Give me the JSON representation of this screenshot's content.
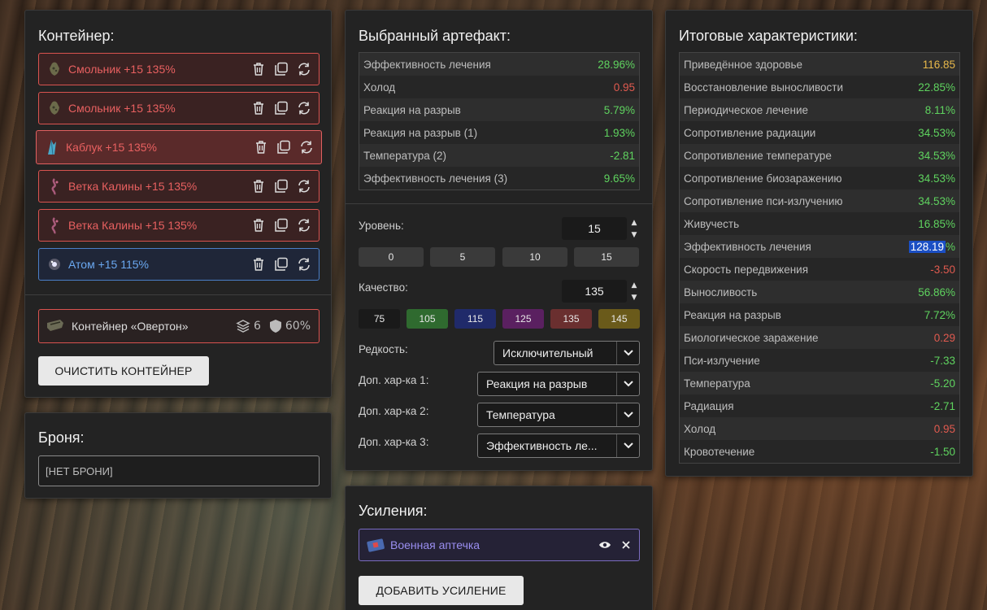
{
  "container": {
    "title": "Контейнер:",
    "items": [
      {
        "label": "Смольник +15 135%"
      },
      {
        "label": "Смольник +15 135%"
      },
      {
        "label": "Каблук +15 135%"
      },
      {
        "label": "Ветка Калины +15 135%"
      },
      {
        "label": "Ветка Калины +15 135%"
      },
      {
        "label": "Атом +15 115%"
      }
    ],
    "overton": {
      "label": "Контейнер «Овертон»",
      "slots": "6",
      "protection": "60%"
    },
    "clear_label": "ОЧИСТИТЬ КОНТЕЙНЕР"
  },
  "armor": {
    "title": "Броня:",
    "value": "[НЕТ БРОНИ]"
  },
  "artifact": {
    "title": "Выбранный артефакт:",
    "stats": [
      {
        "name": "Эффективность лечения",
        "value": "28.96%",
        "color": "#5fd35f"
      },
      {
        "name": "Холод",
        "value": "0.95",
        "color": "#e05a4f"
      },
      {
        "name": "Реакция на разрыв",
        "value": "5.79%",
        "color": "#5fd35f"
      },
      {
        "name": "Реакция на разрыв (1)",
        "value": "1.93%",
        "color": "#5fd35f"
      },
      {
        "name": "Температура (2)",
        "value": "-2.81",
        "color": "#5fd35f"
      },
      {
        "name": "Эффективность лечения (3)",
        "value": "9.65%",
        "color": "#5fd35f"
      }
    ],
    "level_label": "Уровень:",
    "level_value": "15",
    "level_presets": [
      "0",
      "5",
      "10",
      "15"
    ],
    "quality_label": "Качество:",
    "quality_value": "135",
    "quality_presets": [
      {
        "label": "75",
        "color": "#1a1a1a"
      },
      {
        "label": "105",
        "color": "#2f6a2f"
      },
      {
        "label": "115",
        "color": "#202a6a"
      },
      {
        "label": "125",
        "color": "#5a2060"
      },
      {
        "label": "135",
        "color": "#6a2f2f"
      },
      {
        "label": "145",
        "color": "#6a5a1a"
      }
    ],
    "rarity_label": "Редкость:",
    "rarity_value": "Исключительный",
    "extra1_label": "Доп. хар-ка 1:",
    "extra1_value": "Реакция на разрыв",
    "extra2_label": "Доп. хар-ка 2:",
    "extra2_value": "Температура",
    "extra3_label": "Доп. хар-ка 3:",
    "extra3_value": "Эффективность ле..."
  },
  "boosts": {
    "title": "Усиления:",
    "item_label": "Военная аптечка",
    "add_label": "ДОБАВИТЬ УСИЛЕНИЕ"
  },
  "totals": {
    "title": "Итоговые характеристики:",
    "stats": [
      {
        "name": "Приведённое здоровье",
        "value": "116.85",
        "color": "#e8b84a"
      },
      {
        "name": "Восстановление выносливости",
        "value": "22.85%",
        "color": "#5fd35f"
      },
      {
        "name": "Периодическое лечение",
        "value": "8.11%",
        "color": "#5fd35f"
      },
      {
        "name": "Сопротивление радиации",
        "value": "34.53%",
        "color": "#5fd35f"
      },
      {
        "name": "Сопротивление температуре",
        "value": "34.53%",
        "color": "#5fd35f"
      },
      {
        "name": "Сопротивление биозаражению",
        "value": "34.53%",
        "color": "#5fd35f"
      },
      {
        "name": "Сопротивление пси-излучению",
        "value": "34.53%",
        "color": "#5fd35f"
      },
      {
        "name": "Живучесть",
        "value": "16.85%",
        "color": "#5fd35f"
      },
      {
        "name": "Эффективность лечения",
        "value_hl": "128.19",
        "value": "%",
        "color": "#5fd35f"
      },
      {
        "name": "Скорость передвижения",
        "value": "-3.50",
        "color": "#e05a4f"
      },
      {
        "name": "Выносливость",
        "value": "56.86%",
        "color": "#5fd35f"
      },
      {
        "name": "Реакция на разрыв",
        "value": "7.72%",
        "color": "#5fd35f"
      },
      {
        "name": "Биологическое заражение",
        "value": "0.29",
        "color": "#e05a4f"
      },
      {
        "name": "Пси-излучение",
        "value": "-7.33",
        "color": "#5fd35f"
      },
      {
        "name": "Температура",
        "value": "-5.20",
        "color": "#5fd35f"
      },
      {
        "name": "Радиация",
        "value": "-2.71",
        "color": "#5fd35f"
      },
      {
        "name": "Холод",
        "value": "0.95",
        "color": "#e05a4f"
      },
      {
        "name": "Кровотечение",
        "value": "-1.50",
        "color": "#5fd35f"
      }
    ]
  }
}
